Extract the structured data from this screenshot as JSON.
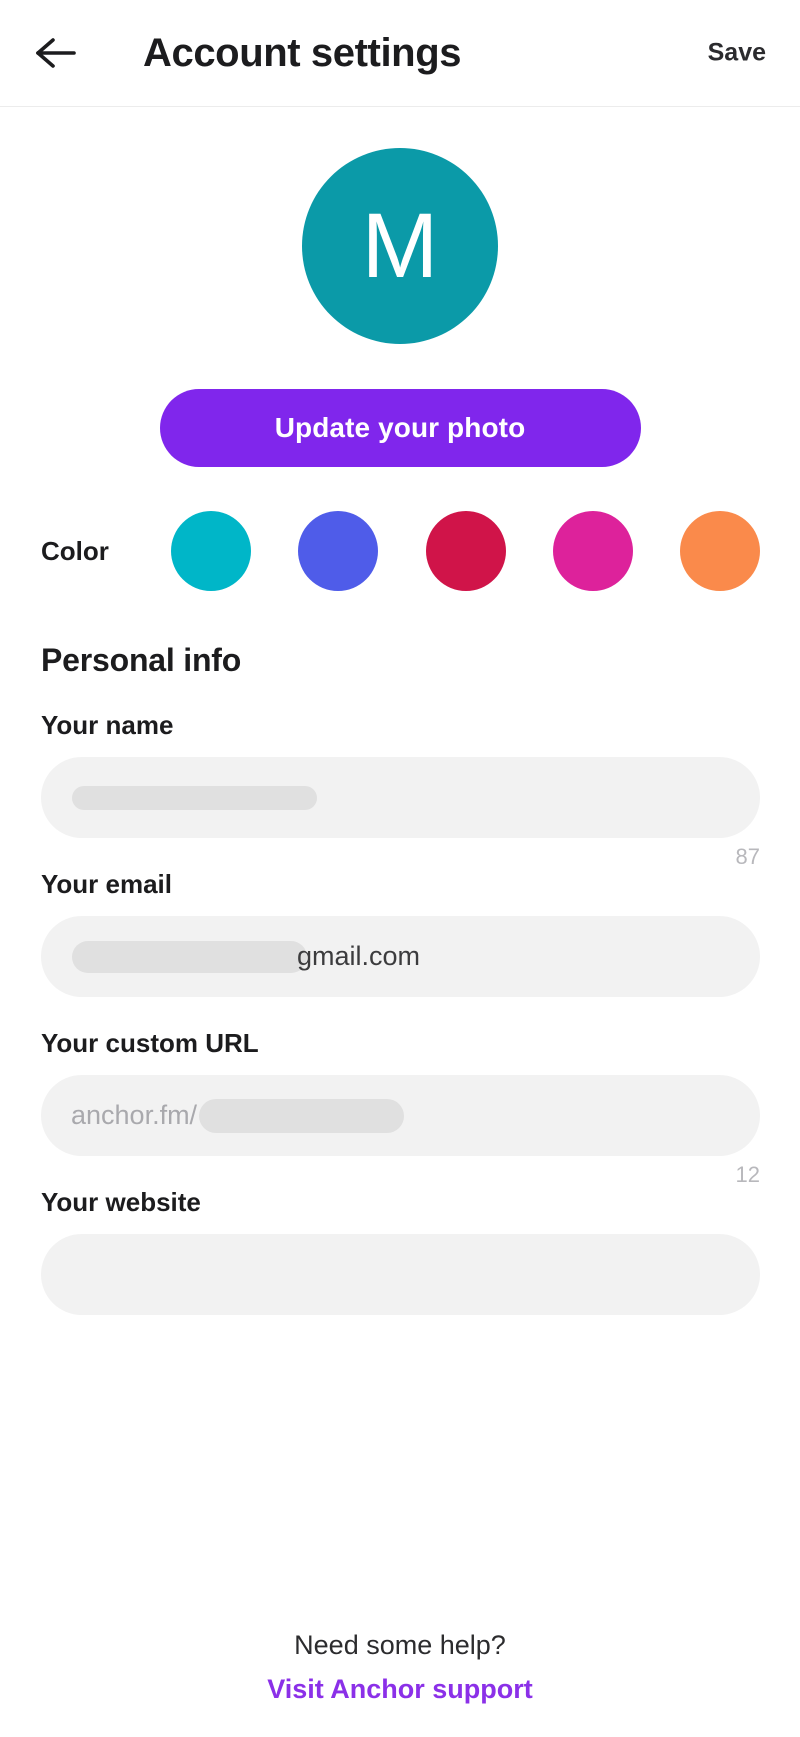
{
  "header": {
    "back_icon": "arrow-left-icon",
    "title": "Account settings",
    "save_label": "Save"
  },
  "profile": {
    "avatar_initial": "M",
    "avatar_color": "#0b9aa8",
    "update_photo_label": "Update your photo",
    "update_photo_color": "#8026ec"
  },
  "color_picker": {
    "label": "Color",
    "swatches": [
      {
        "name": "cyan",
        "hex": "#00b6c8",
        "selected": true
      },
      {
        "name": "blue",
        "hex": "#4f5ce9",
        "selected": false
      },
      {
        "name": "crimson",
        "hex": "#d01449",
        "selected": false
      },
      {
        "name": "magenta",
        "hex": "#dd229b",
        "selected": false
      },
      {
        "name": "orange",
        "hex": "#fa8a4b",
        "selected": false
      }
    ]
  },
  "personal_info": {
    "section_title": "Personal info",
    "fields": [
      {
        "key": "name",
        "label": "Your name",
        "value": "",
        "placeholder": "",
        "redacted": true,
        "counter": "87"
      },
      {
        "key": "email",
        "label": "Your email",
        "value": "gmail.com",
        "placeholder": "",
        "redacted": true,
        "counter": ""
      },
      {
        "key": "custom_url",
        "label": "Your custom URL",
        "value": "anchor.fm/",
        "placeholder": "anchor.fm/",
        "redacted": true,
        "counter": "12"
      },
      {
        "key": "website",
        "label": "Your website",
        "value": "",
        "placeholder": "",
        "redacted": false,
        "counter": ""
      }
    ]
  },
  "footer": {
    "help_text": "Need some help?",
    "support_link": "Visit Anchor support",
    "link_color": "#8b30e8"
  }
}
